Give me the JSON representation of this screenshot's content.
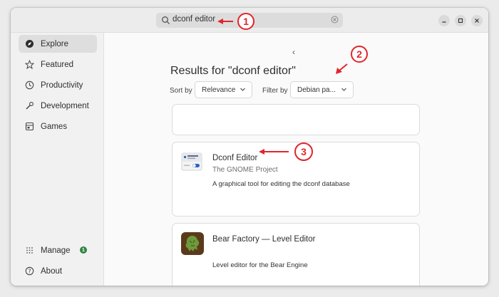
{
  "search": {
    "query": "dconf editor"
  },
  "window_controls": [
    "minimize",
    "maximize",
    "close"
  ],
  "sidebar": {
    "items": [
      {
        "label": "Explore",
        "icon": "compass-icon",
        "active": true
      },
      {
        "label": "Featured",
        "icon": "star-icon"
      },
      {
        "label": "Productivity",
        "icon": "clock-icon"
      },
      {
        "label": "Development",
        "icon": "wrench-icon"
      },
      {
        "label": "Games",
        "icon": "game-icon"
      }
    ],
    "bottom": [
      {
        "label": "Manage",
        "icon": "grid-dots-icon",
        "badge": "1"
      },
      {
        "label": "About",
        "icon": "help-icon"
      }
    ]
  },
  "main": {
    "back_label": "‹",
    "results_title": "Results for \"dconf editor\"",
    "sort_label": "Sort by",
    "sort_value": "Relevance",
    "filter_label": "Filter by",
    "filter_value": "Debian pa..."
  },
  "results": [
    {
      "name": "Dconf Editor",
      "developer": "The GNOME Project",
      "description": "A graphical tool for editing the dconf database",
      "icon": "dconf-editor-icon"
    },
    {
      "name": "Bear Factory — Level Editor",
      "developer": "",
      "description": "Level editor for the Bear Engine",
      "icon": "bear-factory-icon"
    }
  ],
  "annotations": [
    "1",
    "2",
    "3"
  ],
  "colors": {
    "accent": "#e2252b",
    "badge": "#2e8540",
    "active_nav": "#dedede"
  }
}
